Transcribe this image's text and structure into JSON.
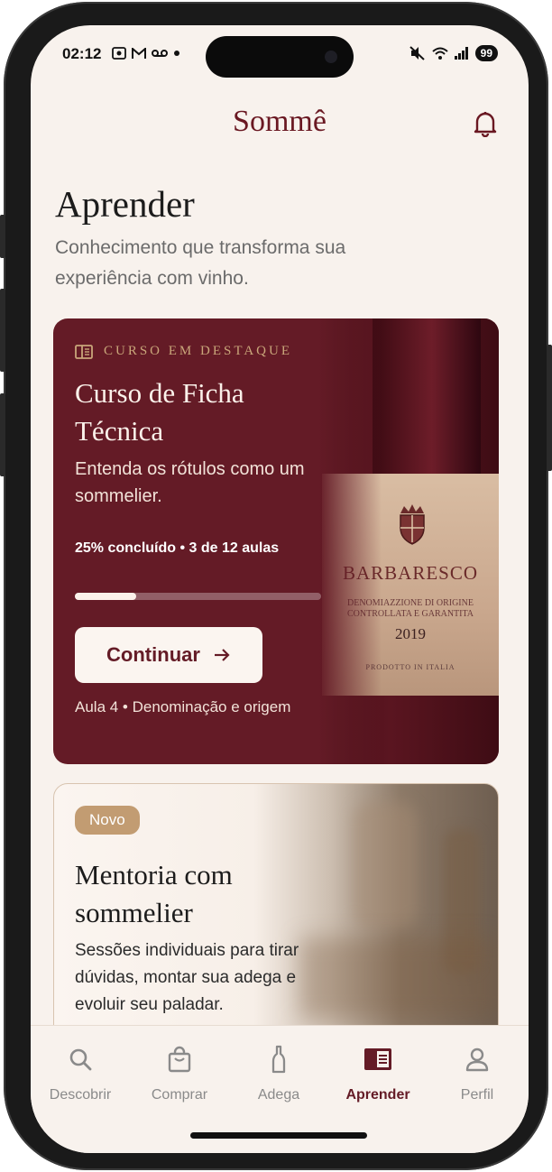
{
  "status_bar": {
    "time": "02:12",
    "left_icons": [
      "screenshot-icon",
      "gmail-icon",
      "voicemail-icon",
      "dot-icon"
    ],
    "right_icons": [
      "mute-icon",
      "wifi-icon",
      "signal-icon"
    ],
    "battery": "99"
  },
  "header": {
    "brand": "Sommê",
    "bell_icon": "bell-icon"
  },
  "page": {
    "title": "Aprender",
    "subtitle": "Conhecimento que transforma sua experiência com vinho."
  },
  "featured": {
    "kicker": "CURSO EM DESTAQUE",
    "title": "Curso de Ficha Técnica",
    "description": "Entenda os rótulos como um sommelier.",
    "progress_text": "25% concluído • 3 de 12 aulas",
    "progress_fraction": 0.25,
    "button_label": "Continuar",
    "next_lesson": "Aula 4 • Denominação e origem",
    "bottle_label": {
      "brand": "BARBARESCO",
      "denomination": "DENOMIAZZIONE DI ORIGINE\nCONTROLLATA E GARANTITA",
      "year": "2019",
      "produced": "PRODOTTO IN ITALIA"
    }
  },
  "mentor": {
    "badge": "Novo",
    "title": "Mentoria com sommelier",
    "description": "Sessões individuais para tirar dúvidas, montar sua adega e evoluir seu paladar."
  },
  "tabs": [
    {
      "label": "Descobrir",
      "icon": "search-icon"
    },
    {
      "label": "Comprar",
      "icon": "shopping-bag-icon"
    },
    {
      "label": "Adega",
      "icon": "bottle-icon"
    },
    {
      "label": "Aprender",
      "icon": "book-icon"
    },
    {
      "label": "Perfil",
      "icon": "user-icon"
    }
  ],
  "colors": {
    "brand": "#641b26",
    "accent_gold": "#c29c72",
    "background": "#f8f2ed"
  }
}
